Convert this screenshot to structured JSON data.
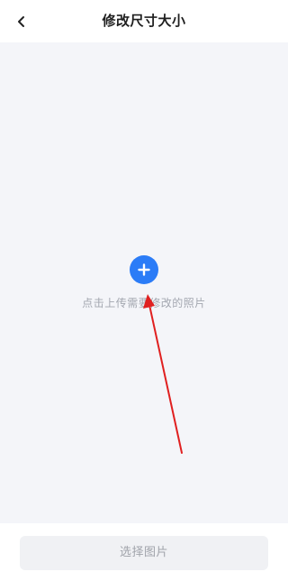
{
  "header": {
    "title": "修改尺寸大小",
    "back_icon": "chevron-left-icon"
  },
  "upload": {
    "add_icon": "plus-icon",
    "hint": "点击上传需要修改的照片"
  },
  "footer": {
    "choose_label": "选择图片"
  },
  "colors": {
    "accent": "#2b7cf7",
    "annotation_arrow": "#e02020"
  }
}
